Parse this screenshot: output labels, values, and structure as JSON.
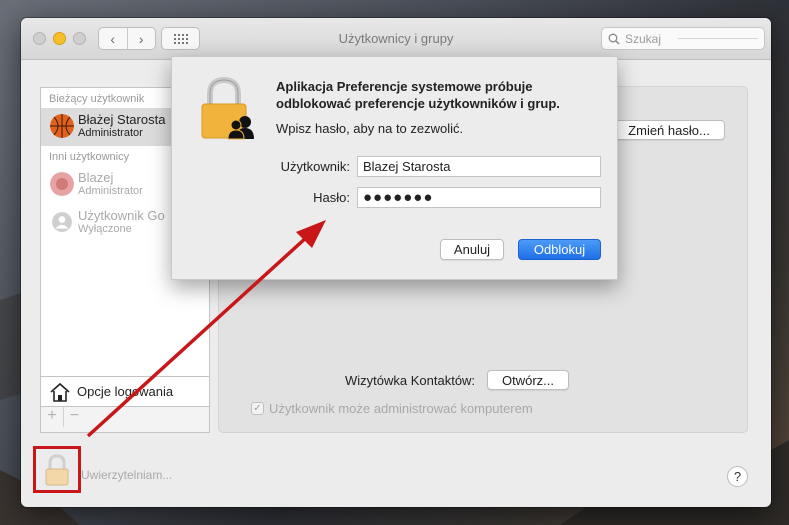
{
  "window": {
    "title": "Użytkownicy i grupy",
    "search_placeholder": "Szukaj"
  },
  "sidebar": {
    "current_header": "Bieżący użytkownik",
    "current_user": {
      "name": "Błażej Starosta",
      "role": "Administrator"
    },
    "others_header": "Inni użytkownicy",
    "other_users": [
      {
        "name": "Blazej",
        "role": "Administrator"
      },
      {
        "name": "Użytkownik Go",
        "role": "Wyłączone"
      }
    ],
    "login_options_label": "Opcje logowania",
    "add_label": "+",
    "remove_label": "−"
  },
  "panel": {
    "change_password_label": "Zmień hasło...",
    "contact_card_label": "Wizytówka Kontaktów:",
    "open_label": "Otwórz...",
    "allow_admin_label": "Użytkownik może administrować komputerem",
    "allow_admin_checked": true
  },
  "lock": {
    "status": "Uwierzytelniam..."
  },
  "help_label": "?",
  "dialog": {
    "title": "Aplikacja Preferencje systemowe próbuje odblokować preferencje użytkowników i grup.",
    "message": "Wpisz hasło, aby na to zezwolić.",
    "username_label": "Użytkownik:",
    "username_value": "Blazej Starosta",
    "password_label": "Hasło:",
    "password_value": "●●●●●●●",
    "cancel_label": "Anuluj",
    "unlock_label": "Odblokuj"
  },
  "colors": {
    "accent": "#1f6fe7",
    "annotation": "#c81619",
    "lock_gold": "#f2b33d"
  }
}
